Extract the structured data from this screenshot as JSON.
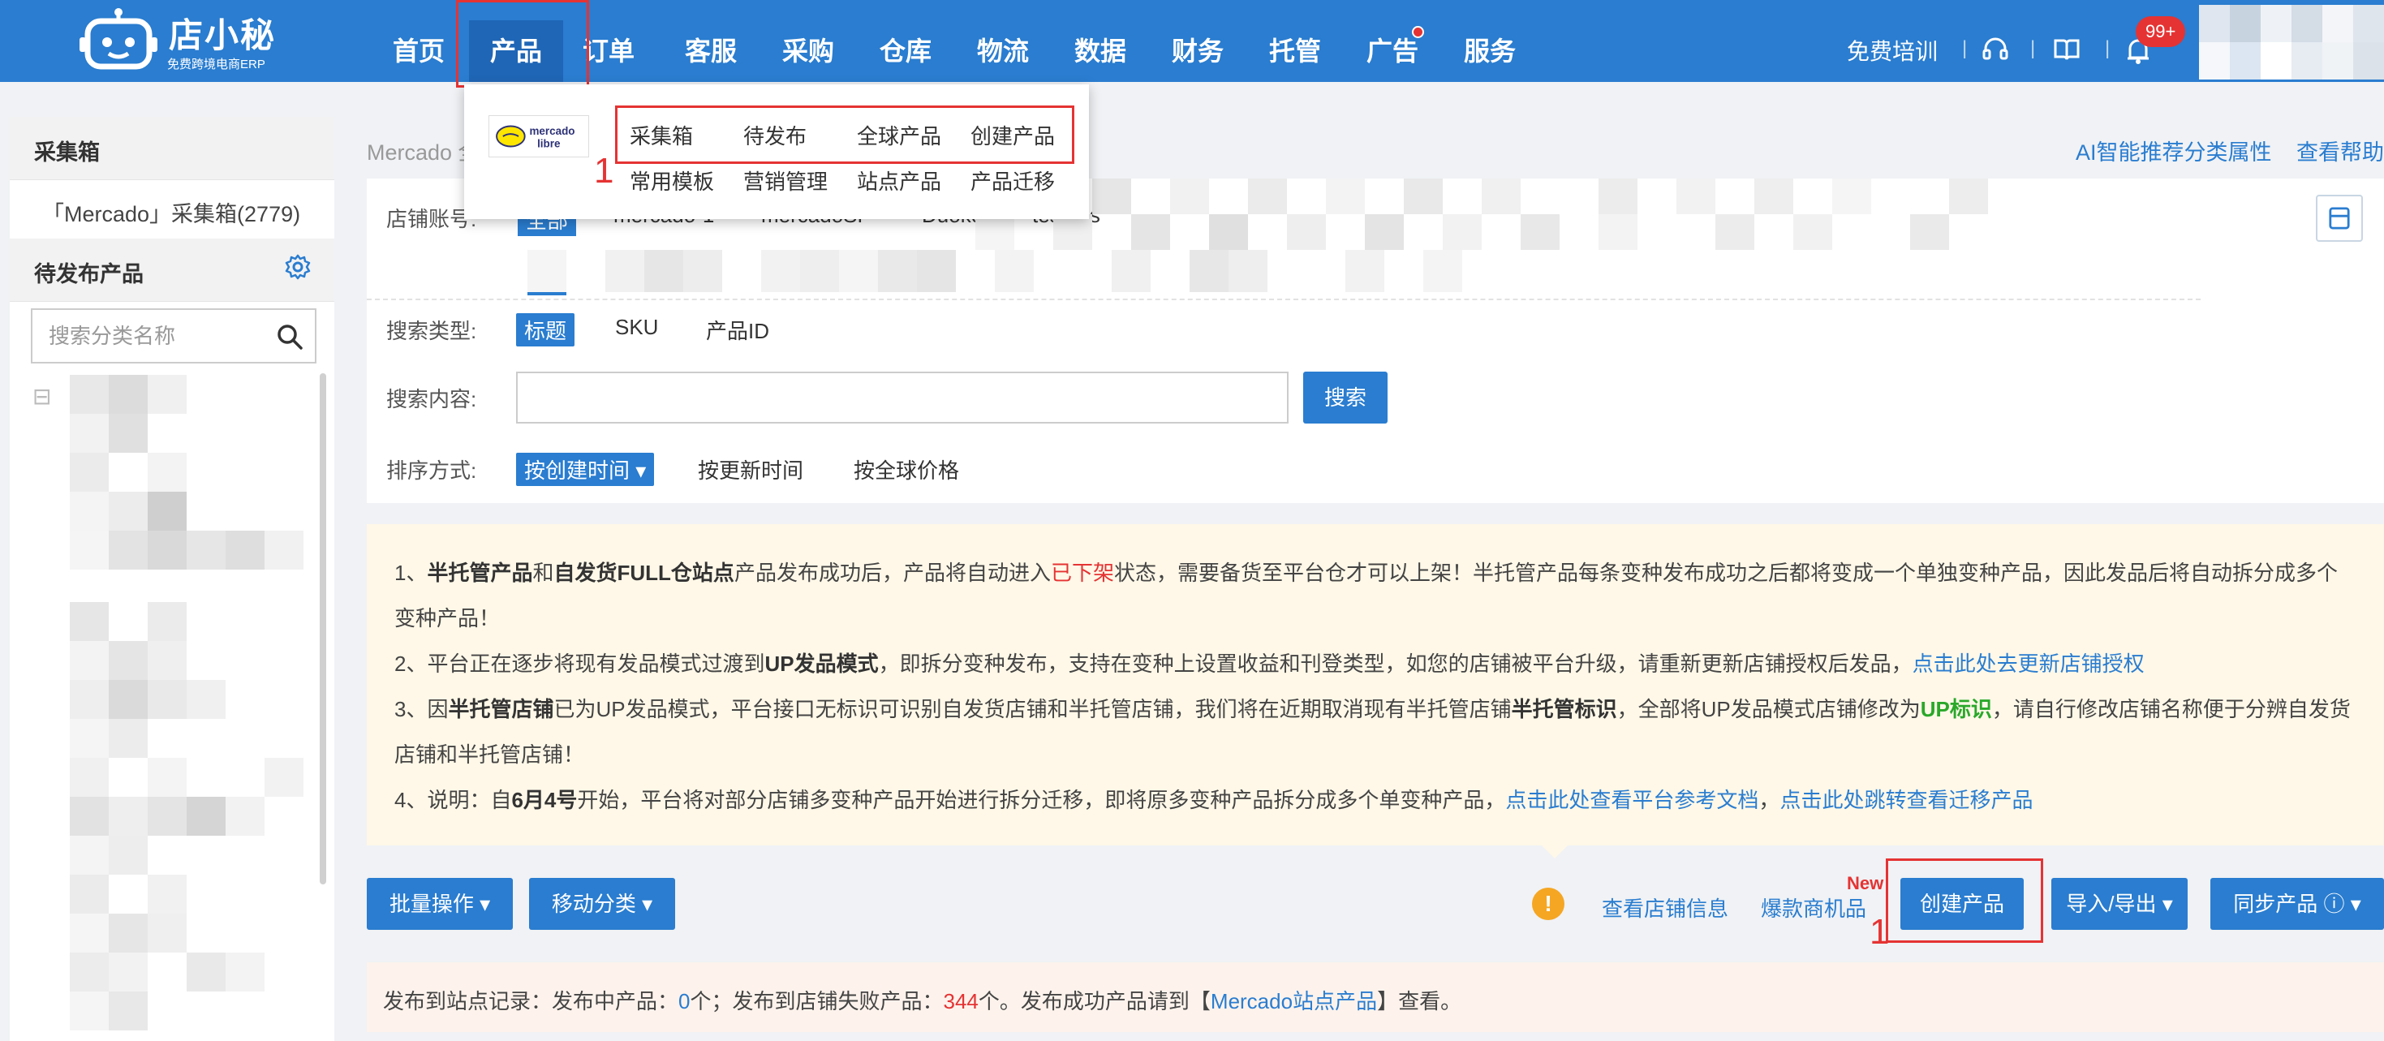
{
  "brand": {
    "name": "店小秘",
    "subtitle": "免费跨境电商ERP"
  },
  "nav": {
    "items": [
      "首页",
      "产品",
      "订单",
      "客服",
      "采购",
      "仓库",
      "物流",
      "数据",
      "财务",
      "托管",
      "广告",
      "服务"
    ],
    "active": "产品",
    "training": "免费培训",
    "notification_count": "99+"
  },
  "dropdown": {
    "logo_text_1": "mercado",
    "logo_text_2": "libre",
    "row1": [
      "采集箱",
      "待发布",
      "全球产品",
      "创建产品"
    ],
    "row2": [
      "常用模板",
      "营销管理",
      "站点产品",
      "产品迁移"
    ]
  },
  "annotations": {
    "step1": "1",
    "step2": "1"
  },
  "sidebar": {
    "section1_title": "采集箱",
    "collect_box": "「Mercado」采集箱(2779)",
    "section2_title": "待发布产品",
    "search_placeholder": "搜索分类名称",
    "tree_toggle": "⊟"
  },
  "main": {
    "breadcrumb": "Mercado 全",
    "ai_link": "AI智能推荐分类属性",
    "help_link": "查看帮助",
    "store_label": "店铺账号:",
    "store_tabs": [
      "全部",
      "mercado-1",
      "mercadoSP",
      "Duoke",
      "test_us"
    ],
    "search_type_label": "搜索类型:",
    "search_types": [
      "标题",
      "SKU",
      "产品ID"
    ],
    "search_content_label": "搜索内容:",
    "search_value": "",
    "search_button": "搜索",
    "sort_label": "排序方式:",
    "sort_options": [
      "按创建时间 ▾",
      "按更新时间",
      "按全球价格"
    ]
  },
  "notice": {
    "l1_a": "1、",
    "l1_b": "半托管产品",
    "l1_c": "和",
    "l1_d": "自发货FULL仓站点",
    "l1_e": "产品发布成功后，产品将自动进入",
    "l1_f": "已下架",
    "l1_g": "状态，需要备货至平台仓才可以上架！半托管产品每条变种发布成功之后都将变成一个单独变种产品，因此发品后将自动拆分成多个",
    "l1_h": "变种产品！",
    "l2_a": "2、平台正在逐步将现有发品模式过渡到",
    "l2_b": "UP发品模式",
    "l2_c": "，即拆分变种发布，支持在变种上设置收益和刊登类型，如您的店铺被平台升级，请重新更新店铺授权后发品，",
    "l2_d": "点击此处去更新店铺授权",
    "l3_a": "3、因",
    "l3_b": "半托管店铺",
    "l3_c": "已为UP发品模式，平台接口无标识可识别自发货店铺和半托管店铺，我们将在近期取消现有半托管店铺",
    "l3_d": "半托管标识",
    "l3_e": "，全部将UP发品模式店铺修改为",
    "l3_f": "UP标识",
    "l3_g": "，请自行修改店铺名称便于分辨自发货",
    "l3_h": "店铺和半托管店铺！",
    "l4_a": "4、说明：自",
    "l4_b": "6月4号",
    "l4_c": "开始，平台将对部分店铺多变种产品开始进行拆分迁移，即将原多变种产品拆分成多个单变种产品，",
    "l4_d": "点击此处查看平台参考文档",
    "l4_e": "，",
    "l4_f": "点击此处跳转查看迁移产品"
  },
  "actions": {
    "batch": "批量操作 ▾",
    "move": "移动分类 ▾",
    "warn": "!",
    "store_info": "查看店铺信息",
    "hot_products": "爆款商机品",
    "new_tag": "New",
    "create": "创建产品",
    "import_export": "导入/导出 ▾",
    "sync": "同步产品 ⓘ ▾"
  },
  "status": {
    "a": "发布到站点记录：发布中产品：",
    "publishing": "0",
    "b": "个；发布到店铺失败产品：",
    "failed": "344",
    "c": "个。发布成功产品请到【",
    "link": "Mercado站点产品",
    "d": "】查看。"
  },
  "colors": {
    "primary": "#2a7dd0",
    "danger": "#e53333",
    "notice_bg": "#fff8e8",
    "success": "#2aa82a"
  }
}
